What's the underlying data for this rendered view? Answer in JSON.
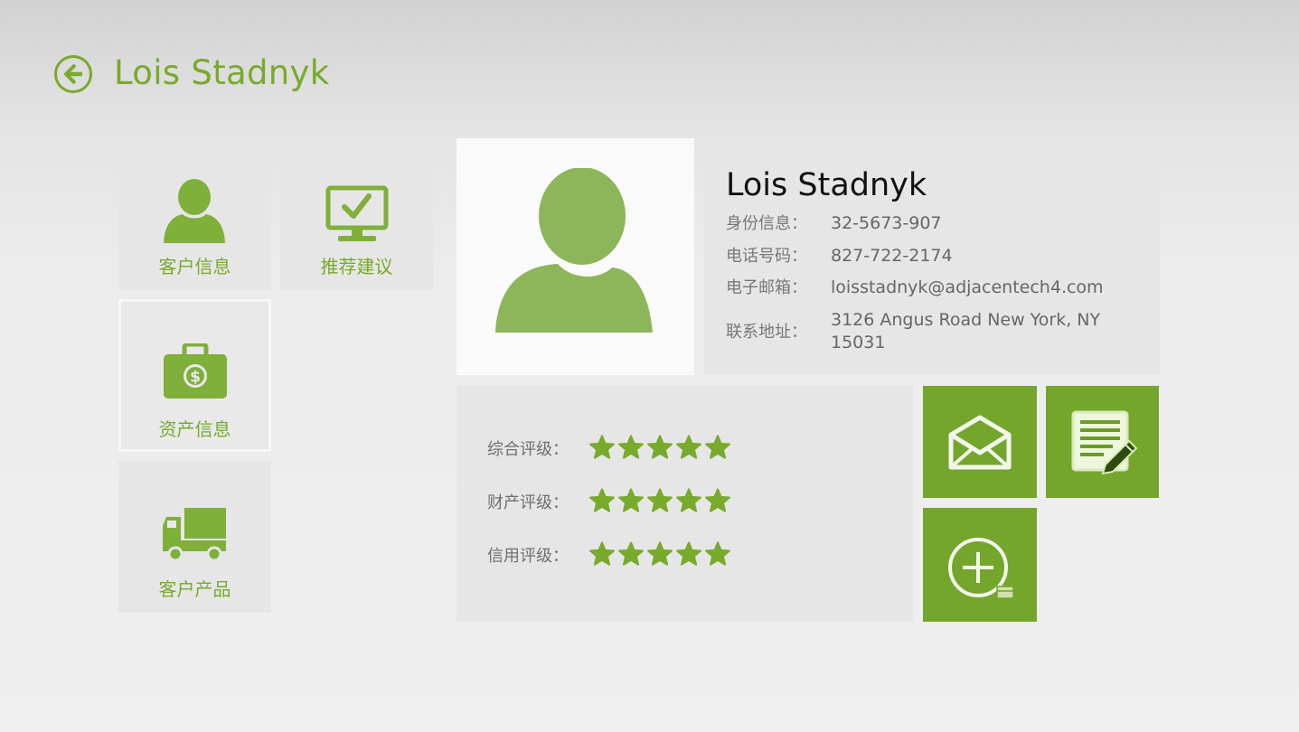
{
  "header": {
    "title": "Lois Stadnyk"
  },
  "nav": {
    "customer_info": "客户信息",
    "recommendations": "推荐建议",
    "asset_info": "资产信息",
    "customer_products": "客户产品"
  },
  "profile": {
    "name": "Lois Stadnyk",
    "id_label": "身份信息：",
    "id_value": "32-5673-907",
    "phone_label": "电话号码：",
    "phone_value": "827-722-2174",
    "email_label": "电子邮箱：",
    "email_value": "loisstadnyk@adjacentech4.com",
    "address_label": "联系地址：",
    "address_value": "3126 Angus Road New York, NY 15031"
  },
  "ratings": [
    {
      "label": "综合评级：",
      "stars": 5
    },
    {
      "label": "财产评级：",
      "stars": 5
    },
    {
      "label": "信用评级：",
      "stars": 5
    }
  ],
  "icons": {
    "back": "back-arrow-icon",
    "customer_info": "person-icon",
    "recommendations": "monitor-check-icon",
    "asset_info": "money-briefcase-icon",
    "customer_products": "truck-icon",
    "email": "envelope-icon",
    "notes": "notepad-pencil-icon",
    "add": "plus-circle-icon"
  },
  "colors": {
    "accent": "#78aa2c",
    "tile_green": "#74a62b",
    "avatar_green": "#8db55a"
  }
}
